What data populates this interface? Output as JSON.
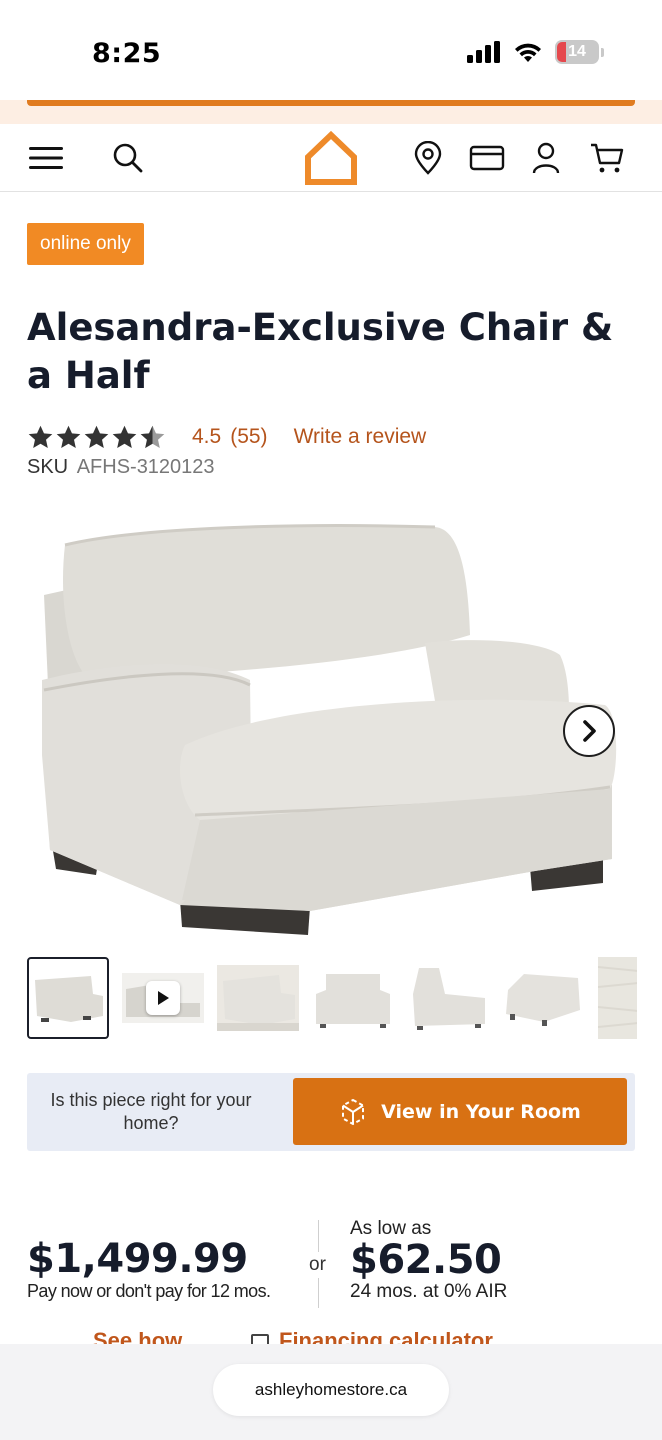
{
  "status_bar": {
    "time": "8:25",
    "battery": "14",
    "icons": [
      "cellular-signal-icon",
      "wifi-icon",
      "battery-icon"
    ]
  },
  "header": {
    "icons": [
      "menu-icon",
      "search-icon",
      "home-logo-icon",
      "location-pin-icon",
      "credit-card-icon",
      "account-icon",
      "cart-icon"
    ],
    "brand_color": "#e07b1f"
  },
  "product": {
    "badge": "online only",
    "title": "Alesandra-Exclusive Chair & a Half",
    "rating": {
      "stars": 4.5,
      "value": "4.5",
      "count": "(55)",
      "write_review": "Write a review"
    },
    "sku_label": "SKU",
    "sku": "AFHS-3120123",
    "thumbnails": [
      {
        "kind": "image",
        "active": true
      },
      {
        "kind": "video",
        "active": false
      },
      {
        "kind": "image",
        "active": false
      },
      {
        "kind": "image",
        "active": false
      },
      {
        "kind": "image",
        "active": false
      },
      {
        "kind": "image",
        "active": false
      },
      {
        "kind": "swatch",
        "active": false
      }
    ]
  },
  "room": {
    "question": "Is this piece right for your home?",
    "button": "View in Your Room"
  },
  "pricing": {
    "price": "$1,499.99",
    "price_note": "Pay now or don't pay for 12 mos.",
    "or": "or",
    "as_low_as": "As low as",
    "monthly": "$62.50",
    "terms": "24 mos. at 0% AIR",
    "see_how": "See how",
    "financing_calculator": "Financing calculator"
  },
  "browser": {
    "url": "ashleyhomestore.ca"
  },
  "colors": {
    "accent": "#d87113",
    "badge": "#f18a24",
    "link": "#b5541c",
    "room_box": "#e8ecf5"
  }
}
